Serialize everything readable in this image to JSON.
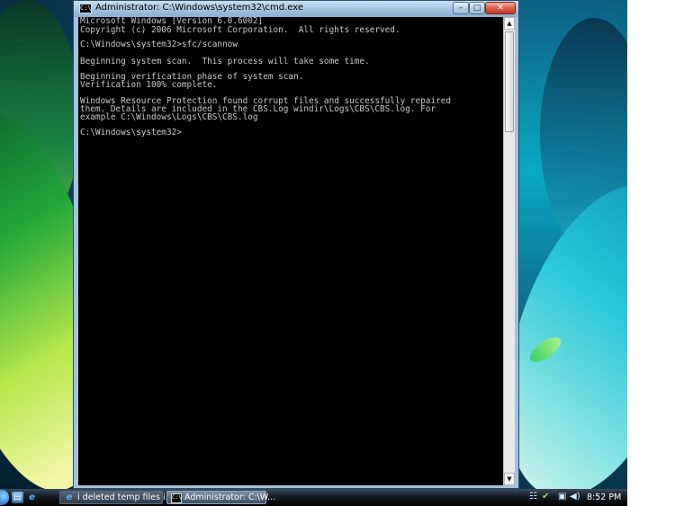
{
  "window": {
    "title": "Administrator: C:\\Windows\\system32\\cmd.exe",
    "icon": "cmd-icon",
    "icon_glyph": "C:\\",
    "buttons": {
      "minimize": "–",
      "maximize": "□",
      "close": "✕"
    }
  },
  "console": {
    "lines": [
      "Microsoft Windows [Version 6.0.6002]",
      "Copyright (c) 2006 Microsoft Corporation.  All rights reserved.",
      "",
      "C:\\Windows\\system32>sfc/scannow",
      "",
      "Beginning system scan.  This process will take some time.",
      "",
      "Beginning verification phase of system scan.",
      "Verification 100% complete.",
      "",
      "Windows Resource Protection found corrupt files and successfully repaired",
      "them. Details are included in the CBS.Log windir\\Logs\\CBS\\CBS.log. For",
      "example C:\\Windows\\Logs\\CBS\\CBS.log",
      "",
      "C:\\Windows\\system32>"
    ]
  },
  "scrollbar": {
    "up_arrow": "▲",
    "down_arrow": "▼"
  },
  "taskbar": {
    "quick_launch": {
      "desktop_icon": "▤",
      "ie_icon": "e"
    },
    "tasks": [
      {
        "label": "i deleted temp files i...",
        "icon": "ie-icon",
        "glyph": "e"
      },
      {
        "label": "Administrator: C:\\W...",
        "icon": "cmd-icon",
        "glyph": "C:\\"
      }
    ],
    "tray": {
      "network_icon": "☷",
      "update_icon": "✔",
      "monitor_icon": "▣",
      "volume_icon": "◀)",
      "clock": "8:52 PM"
    }
  },
  "colors": {
    "console_bg": "#000000",
    "console_text": "#c8c8c8",
    "taskbar": "#141c24",
    "title_bar": "#9ebfdd"
  }
}
